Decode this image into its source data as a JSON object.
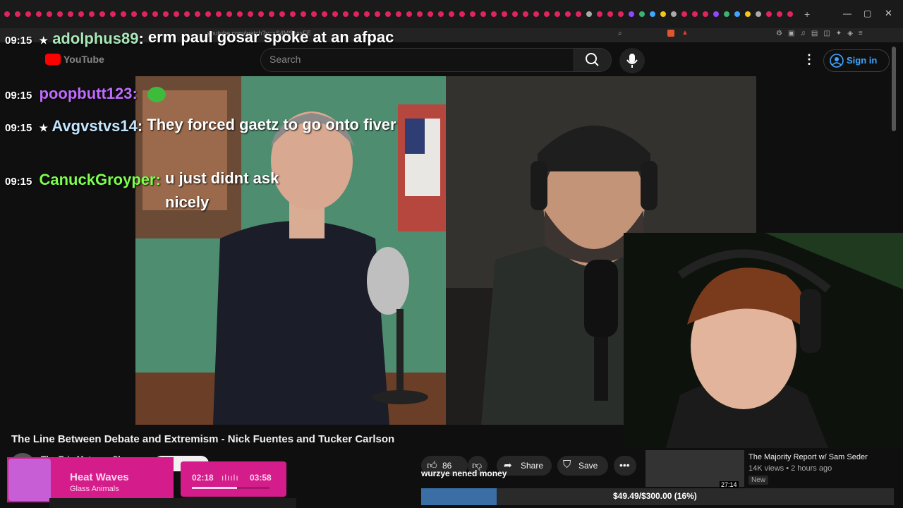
{
  "browser": {
    "url": "youtube.com/watch?v=xS4MShxsFE"
  },
  "youtube": {
    "logo_text": "YouTube",
    "search_placeholder": "Search",
    "sign_in": "Sign in"
  },
  "chat": [
    {
      "time": "09:15",
      "user": "adolphus89",
      "message": "erm paul gosar spoke at an afpac",
      "user_color": "#a9e8b8"
    },
    {
      "time": "09:15",
      "user": "poopbutt123",
      "message": "",
      "user_color": "#c06bff"
    },
    {
      "time": "09:15",
      "user": "Avgvstvs14",
      "message": "They forced gaetz to go onto fiver",
      "user_color": "#c3e6ff"
    },
    {
      "time": "09:15",
      "user": "CanuckGroyper",
      "message": "u just didnt ask nicely",
      "user_color": "#7cff4d"
    }
  ],
  "video": {
    "title": "The Line Between Debate and Extremism - Nick Fuentes and Tucker Carlson",
    "channel": "The Eric Metaxas Show",
    "likes": "86",
    "share": "Share",
    "save": "Save"
  },
  "overlay": {
    "song_title": "Heat Waves",
    "song_artist": "Glass Animals",
    "time_elapsed": "02:18",
    "time_total": "03:58",
    "song_progress": 0.58,
    "donation_message": "wurzye nened money",
    "donation_goal": "$49.49/$300.00 (16%)",
    "donation_fraction": 0.16
  },
  "recommended": {
    "title": "The Majority Report w/ Sam Seder",
    "meta": "14K views • 2 hours ago",
    "badge": "New",
    "duration": "27:14"
  },
  "colors": {
    "accent_pink": "#d41d8a",
    "link_blue": "#3ea6ff",
    "donation_blue": "#3b6ea5"
  }
}
